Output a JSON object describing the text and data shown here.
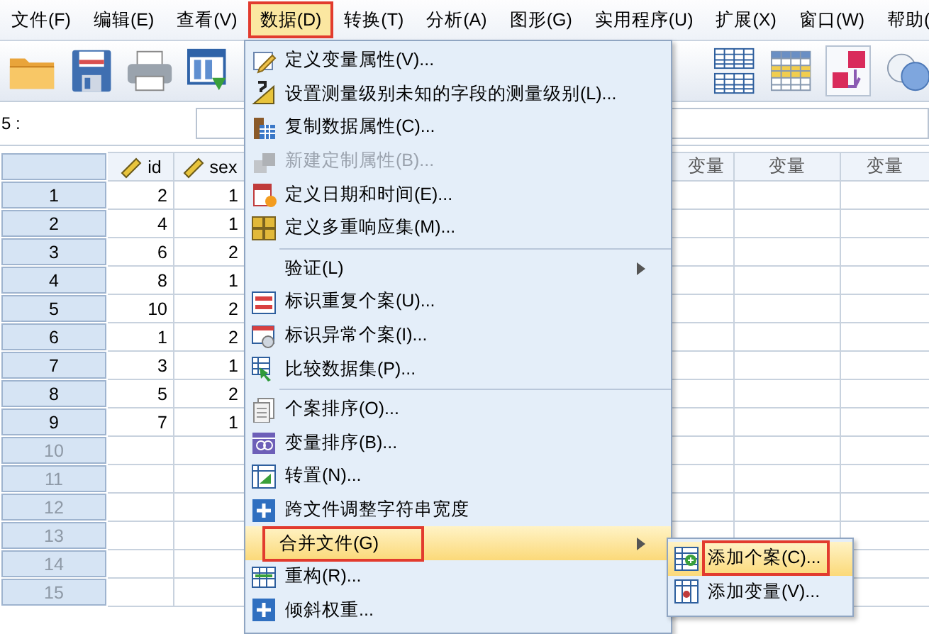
{
  "menubar": [
    {
      "label": "文件(F)",
      "selected": false,
      "annotated": false
    },
    {
      "label": "编辑(E)",
      "selected": false,
      "annotated": false
    },
    {
      "label": "查看(V)",
      "selected": false,
      "annotated": false
    },
    {
      "label": "数据(D)",
      "selected": true,
      "annotated": true
    },
    {
      "label": "转换(T)",
      "selected": false,
      "annotated": false
    },
    {
      "label": "分析(A)",
      "selected": false,
      "annotated": false
    },
    {
      "label": "图形(G)",
      "selected": false,
      "annotated": false
    },
    {
      "label": "实用程序(U)",
      "selected": false,
      "annotated": false
    },
    {
      "label": "扩展(X)",
      "selected": false,
      "annotated": false
    },
    {
      "label": "窗口(W)",
      "selected": false,
      "annotated": false
    },
    {
      "label": "帮助(",
      "selected": false,
      "annotated": false
    }
  ],
  "cell_reference": {
    "label": "5 :"
  },
  "grid": {
    "columns": [
      {
        "label": "id",
        "kind": "variable"
      },
      {
        "label": "sex",
        "kind": "variable"
      },
      {
        "label": "变量",
        "kind": "empty"
      },
      {
        "label": "变量",
        "kind": "empty"
      },
      {
        "label": "变量",
        "kind": "empty"
      }
    ],
    "rows": [
      {
        "label": "1",
        "filled": true,
        "cells": [
          "2",
          "1"
        ]
      },
      {
        "label": "2",
        "filled": true,
        "cells": [
          "4",
          "1"
        ]
      },
      {
        "label": "3",
        "filled": true,
        "cells": [
          "6",
          "2"
        ]
      },
      {
        "label": "4",
        "filled": true,
        "cells": [
          "8",
          "1"
        ]
      },
      {
        "label": "5",
        "filled": true,
        "cells": [
          "10",
          "2"
        ]
      },
      {
        "label": "6",
        "filled": true,
        "cells": [
          "1",
          "2"
        ]
      },
      {
        "label": "7",
        "filled": true,
        "cells": [
          "3",
          "1"
        ]
      },
      {
        "label": "8",
        "filled": true,
        "cells": [
          "5",
          "2"
        ]
      },
      {
        "label": "9",
        "filled": true,
        "cells": [
          "7",
          "1"
        ]
      },
      {
        "label": "10",
        "filled": false,
        "cells": []
      },
      {
        "label": "11",
        "filled": false,
        "cells": []
      },
      {
        "label": "12",
        "filled": false,
        "cells": []
      },
      {
        "label": "13",
        "filled": false,
        "cells": []
      },
      {
        "label": "14",
        "filled": false,
        "cells": []
      },
      {
        "label": "15",
        "filled": false,
        "cells": []
      }
    ]
  },
  "data_menu": {
    "items": [
      {
        "kind": "item",
        "label": "定义变量属性(V)...",
        "disabled": false,
        "submenu": false,
        "selected": false,
        "annotated": false
      },
      {
        "kind": "item",
        "label": "设置测量级别未知的字段的测量级别(L)...",
        "disabled": false,
        "submenu": false,
        "selected": false,
        "annotated": false
      },
      {
        "kind": "item",
        "label": "复制数据属性(C)...",
        "disabled": false,
        "submenu": false,
        "selected": false,
        "annotated": false
      },
      {
        "kind": "item",
        "label": "新建定制属性(B)...",
        "disabled": true,
        "submenu": false,
        "selected": false,
        "annotated": false
      },
      {
        "kind": "item",
        "label": "定义日期和时间(E)...",
        "disabled": false,
        "submenu": false,
        "selected": false,
        "annotated": false
      },
      {
        "kind": "item",
        "label": "定义多重响应集(M)...",
        "disabled": false,
        "submenu": false,
        "selected": false,
        "annotated": false
      },
      {
        "kind": "separator"
      },
      {
        "kind": "item",
        "label": "验证(L)",
        "disabled": false,
        "submenu": true,
        "selected": false,
        "annotated": false
      },
      {
        "kind": "item",
        "label": "标识重复个案(U)...",
        "disabled": false,
        "submenu": false,
        "selected": false,
        "annotated": false
      },
      {
        "kind": "item",
        "label": "标识异常个案(I)...",
        "disabled": false,
        "submenu": false,
        "selected": false,
        "annotated": false
      },
      {
        "kind": "item",
        "label": "比较数据集(P)...",
        "disabled": false,
        "submenu": false,
        "selected": false,
        "annotated": false
      },
      {
        "kind": "separator"
      },
      {
        "kind": "item",
        "label": "个案排序(O)...",
        "disabled": false,
        "submenu": false,
        "selected": false,
        "annotated": false
      },
      {
        "kind": "item",
        "label": "变量排序(B)...",
        "disabled": false,
        "submenu": false,
        "selected": false,
        "annotated": false
      },
      {
        "kind": "item",
        "label": "转置(N)...",
        "disabled": false,
        "submenu": false,
        "selected": false,
        "annotated": false
      },
      {
        "kind": "item",
        "label": "跨文件调整字符串宽度",
        "disabled": false,
        "submenu": false,
        "selected": false,
        "annotated": false
      },
      {
        "kind": "item",
        "label": "合并文件(G)",
        "disabled": false,
        "submenu": true,
        "selected": true,
        "annotated": true
      },
      {
        "kind": "item",
        "label": "重构(R)...",
        "disabled": false,
        "submenu": false,
        "selected": false,
        "annotated": false
      },
      {
        "kind": "item",
        "label": "倾斜权重...",
        "disabled": false,
        "submenu": false,
        "selected": false,
        "annotated": false
      }
    ]
  },
  "merge_submenu": {
    "items": [
      {
        "kind": "item",
        "label": "添加个案(C)...",
        "disabled": false,
        "submenu": false,
        "selected": true,
        "annotated": true
      },
      {
        "kind": "item",
        "label": "添加变量(V)...",
        "disabled": false,
        "submenu": false,
        "selected": false,
        "annotated": false
      }
    ]
  }
}
